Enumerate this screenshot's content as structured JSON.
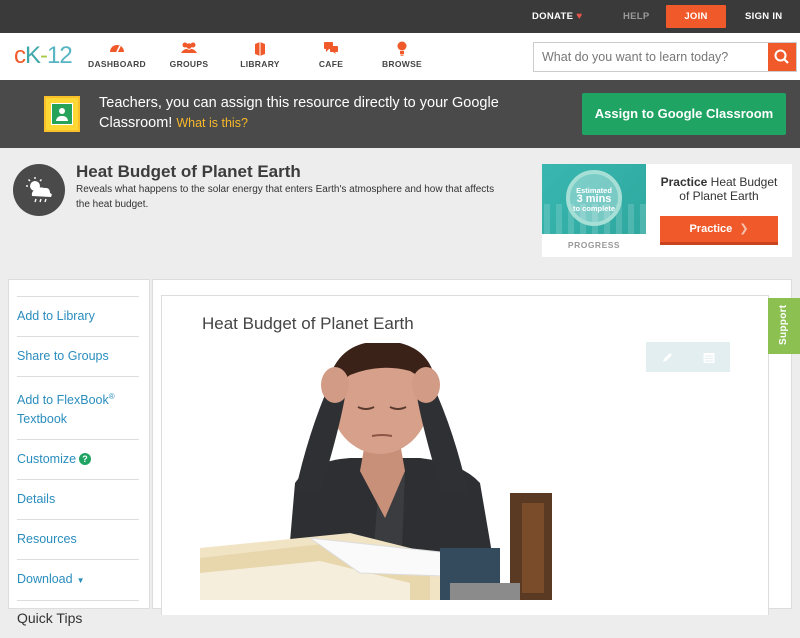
{
  "topbar": {
    "donate": "DONATE",
    "help": "HELP",
    "join": "JOIN",
    "sign_in": "SIGN IN"
  },
  "nav": {
    "logo": {
      "c": "c",
      "k": "K",
      "dash": "-",
      "n": "12"
    },
    "items": [
      {
        "label": "DASHBOARD",
        "icon": "dashboard-icon"
      },
      {
        "label": "GROUPS",
        "icon": "groups-icon"
      },
      {
        "label": "LIBRARY",
        "icon": "library-icon"
      },
      {
        "label": "CAFE",
        "icon": "cafe-icon"
      },
      {
        "label": "BROWSE",
        "icon": "browse-icon"
      }
    ],
    "search_placeholder": "What do you want to learn today?"
  },
  "banner": {
    "text": "Teachers, you can assign this resource directly to your Google Classroom!",
    "what_link": "What is this?",
    "assign_button": "Assign to Google Classroom"
  },
  "lesson": {
    "title": "Heat Budget of Planet Earth",
    "description": "Reveals what happens to the solar energy that enters Earth's atmosphere and how that affects the heat budget.",
    "progress": {
      "estimated": "Estimated",
      "mins": "3 mins",
      "to_complete": "to complete",
      "label": "PROGRESS"
    },
    "practice": {
      "bold": "Practice",
      "rest": " Heat Budget of Planet Earth",
      "button": "Practice"
    }
  },
  "sidebar": {
    "items": [
      {
        "label": "Add to Library"
      },
      {
        "label": "Share to Groups"
      },
      {
        "label": "Add to FlexBook",
        "sup": "®",
        "line2": "Textbook"
      },
      {
        "label": "Customize"
      },
      {
        "label": "Details"
      },
      {
        "label": "Resources"
      },
      {
        "label": "Download"
      },
      {
        "label": "Quick Tips"
      }
    ]
  },
  "content": {
    "title": "Heat Budget of Planet Earth",
    "support": "Support"
  },
  "colors": {
    "accent": "#f0592a",
    "green": "#1fa463",
    "link": "#2a8dbe"
  }
}
